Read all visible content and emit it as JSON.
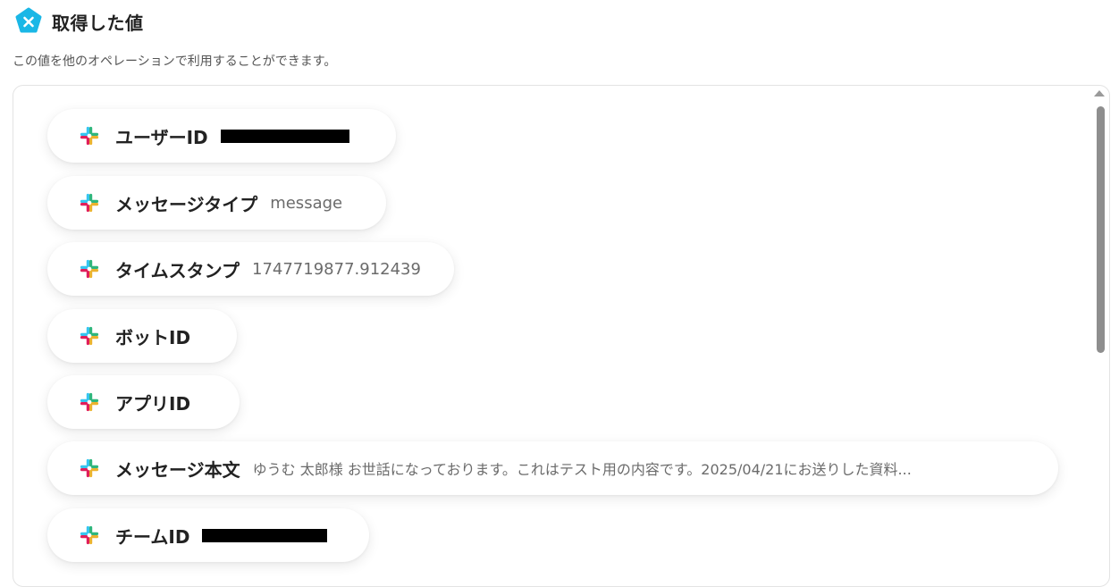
{
  "header": {
    "title": "取得した値",
    "badge_icon": "x-variable-icon",
    "badge_color": "#1ab7e6"
  },
  "subtitle": "この値を他のオペレーションで利用することができます。",
  "items": [
    {
      "label": "ユーザーID",
      "value": "",
      "redacted": true,
      "icon": "slack-icon"
    },
    {
      "label": "メッセージタイプ",
      "value": "message",
      "redacted": false,
      "icon": "slack-icon"
    },
    {
      "label": "タイムスタンプ",
      "value": "1747719877.912439",
      "redacted": false,
      "icon": "slack-icon"
    },
    {
      "label": "ボットID",
      "value": "",
      "redacted": false,
      "icon": "slack-icon"
    },
    {
      "label": "アプリID",
      "value": "",
      "redacted": false,
      "icon": "slack-icon"
    },
    {
      "label": "メッセージ本文",
      "value": "ゆうむ 太郎様 お世話になっております。これはテスト用の内容です。2025/04/21にお送りした資料...",
      "redacted": false,
      "icon": "slack-icon"
    },
    {
      "label": "チームID",
      "value": "",
      "redacted": true,
      "icon": "slack-icon"
    }
  ],
  "colors": {
    "slack_blue": "#36c5f0",
    "slack_green": "#2eb67d",
    "slack_yellow": "#ecb22e",
    "slack_red": "#e01e5a"
  }
}
